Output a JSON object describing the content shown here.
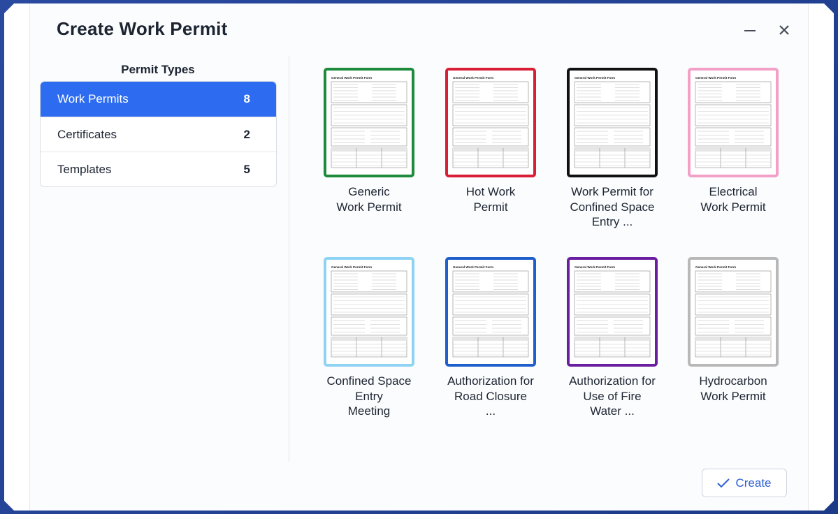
{
  "dialog": {
    "title": "Create Work Permit",
    "minimize_icon": "minimize-icon",
    "close_icon": "close-icon"
  },
  "sidebar": {
    "heading": "Permit Types",
    "items": [
      {
        "label": "Work Permits",
        "count": "8",
        "active": true
      },
      {
        "label": "Certificates",
        "count": "2",
        "active": false
      },
      {
        "label": "Templates",
        "count": "5",
        "active": false
      }
    ]
  },
  "permits": [
    {
      "line1": "Generic",
      "line2": "Work Permit",
      "line3": "",
      "color": "#1e8a3c"
    },
    {
      "line1": "Hot Work",
      "line2": "Permit",
      "line3": "",
      "color": "#d81f35"
    },
    {
      "line1": "Work Permit for",
      "line2": "Confined Space",
      "line3": "Entry ...",
      "color": "#111111"
    },
    {
      "line1": "Electrical",
      "line2": "Work Permit",
      "line3": "",
      "color": "#f2a0c8"
    },
    {
      "line1": "Confined Space",
      "line2": "Entry",
      "line3": "Meeting",
      "color": "#8fd3f4"
    },
    {
      "line1": "Authorization for",
      "line2": "Road Closure",
      "line3": "...",
      "color": "#1f5fcc"
    },
    {
      "line1": "Authorization for",
      "line2": "Use of Fire",
      "line3": "Water ...",
      "color": "#6a1fa0"
    },
    {
      "line1": "Hydrocarbon",
      "line2": "Work Permit",
      "line3": "",
      "color": "#b8b8b8"
    }
  ],
  "thumbnail": {
    "form_title": "General Work Permit Form"
  },
  "footer": {
    "create_label": "Create",
    "create_icon": "check-icon"
  }
}
